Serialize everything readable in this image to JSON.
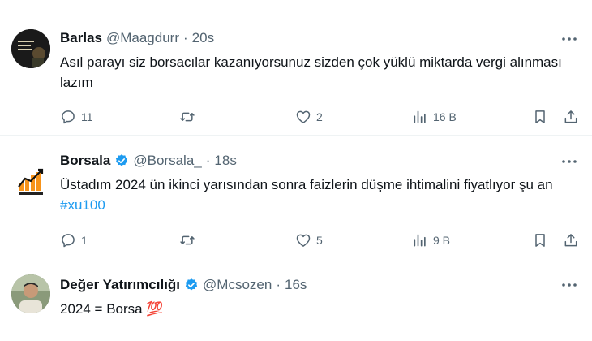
{
  "tweets": [
    {
      "name": "Barlas",
      "handle": "@Maagdurr",
      "sep": "·",
      "time": "20s",
      "verified": false,
      "avatar_text": "Adam\nolduk\nbesinizi",
      "text": "Asıl parayı siz borsacılar kazanıyorsunuz sizden çok yüklü miktarda vergi alınması lazım",
      "replies": "11",
      "retweets": "",
      "likes": "2",
      "views": "16 B"
    },
    {
      "name": "Borsala",
      "handle": "@Borsala_",
      "sep": "·",
      "time": "18s",
      "verified": true,
      "avatar_text": "Borsala",
      "text": "Üstadım 2024 ün ikinci yarısından sonra faizlerin düşme ihtimalini fiyatlıyor şu an ",
      "hashtag": "#xu100",
      "replies": "1",
      "retweets": "",
      "likes": "5",
      "views": "9 B"
    },
    {
      "name": "Değer Yatırımcılığı",
      "handle": "@Mcsozen",
      "sep": "·",
      "time": "16s",
      "verified": true,
      "text": "2024 = Borsa ",
      "emoji": "💯"
    }
  ],
  "colors": {
    "text": "#0f1419",
    "secondary": "#536471",
    "link": "#1d9bf0",
    "verified": "#1d9bf0",
    "divider": "#eff3f4"
  },
  "icons": [
    "reply-icon",
    "retweet-icon",
    "like-icon",
    "views-icon",
    "bookmark-icon",
    "share-icon",
    "more-icon",
    "verified-badge-icon"
  ]
}
